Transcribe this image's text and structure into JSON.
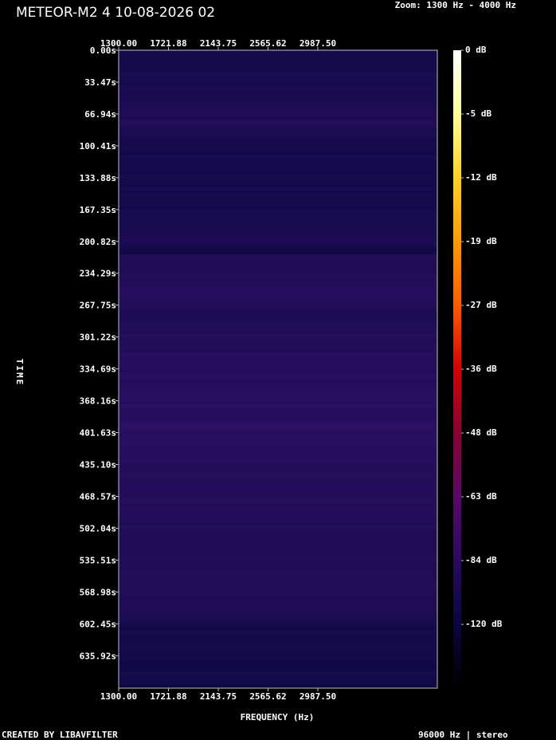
{
  "header": {
    "title": "METEOR-M2 4 10-08-2026 02",
    "zoom": "Zoom: 1300 Hz - 4000 Hz"
  },
  "footer": {
    "left": "CREATED BY LIBAVFILTER",
    "right": "96000 Hz | stereo"
  },
  "chart_data": {
    "type": "heatmap",
    "title": "METEOR-M2 4 10-08-2026 02",
    "xlabel": "FREQUENCY (Hz)",
    "ylabel": "TIME",
    "x_range_hz": [
      1300,
      4000
    ],
    "x_ticks": [
      "1300.00",
      "1721.88",
      "2143.75",
      "2565.62",
      "2987.50"
    ],
    "x_tick_values": [
      1300.0,
      1721.88,
      2143.75,
      2565.62,
      2987.5
    ],
    "y_range_s": [
      0,
      670
    ],
    "y_ticks": [
      "0.00s",
      "33.47s",
      "66.94s",
      "100.41s",
      "133.88s",
      "167.35s",
      "200.82s",
      "234.29s",
      "267.75s",
      "301.22s",
      "334.69s",
      "368.16s",
      "401.63s",
      "435.10s",
      "468.57s",
      "502.04s",
      "535.51s",
      "568.98s",
      "602.45s",
      "635.92s"
    ],
    "y_tick_values": [
      0.0,
      33.47,
      66.94,
      100.41,
      133.88,
      167.35,
      200.82,
      234.29,
      267.75,
      301.22,
      334.69,
      368.16,
      401.63,
      435.1,
      468.57,
      502.04,
      535.51,
      568.98,
      602.45,
      635.92
    ],
    "colorbar": {
      "labels": [
        "0 dB",
        "-5 dB",
        "-12 dB",
        "-19 dB",
        "-27 dB",
        "-36 dB",
        "-48 dB",
        "-63 dB",
        "-84 dB",
        "-120 dB"
      ],
      "stops": [
        "#ffffff",
        "#ffff9a",
        "#ffd21e",
        "#ff9a00",
        "#ff5a00",
        "#d40000",
        "#8a0034",
        "#5a0868",
        "#2a0a60",
        "#0a0640",
        "#000000"
      ]
    },
    "intensity_profile": {
      "time_s": [
        0,
        33,
        62,
        67,
        80,
        100,
        134,
        167,
        180,
        200,
        212,
        215,
        235,
        268,
        280,
        301,
        335,
        368,
        402,
        435,
        469,
        502,
        536,
        569,
        600,
        605,
        636,
        670
      ],
      "level": [
        0.22,
        0.25,
        0.36,
        0.45,
        0.38,
        0.22,
        0.24,
        0.2,
        0.3,
        0.34,
        0.1,
        0.4,
        0.46,
        0.44,
        0.36,
        0.46,
        0.5,
        0.56,
        0.6,
        0.54,
        0.48,
        0.44,
        0.42,
        0.4,
        0.28,
        0.18,
        0.16,
        0.14
      ]
    },
    "grid": false,
    "legend": "right"
  }
}
